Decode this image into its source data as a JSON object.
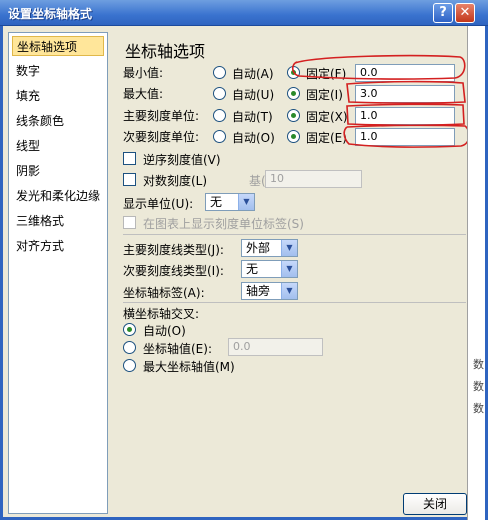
{
  "window": {
    "title": "设置坐标轴格式",
    "help_label": "?",
    "close_glyph": "✕"
  },
  "sidebar": {
    "items": [
      {
        "label": "坐标轴选项",
        "active": true
      },
      {
        "label": "数字"
      },
      {
        "label": "填充"
      },
      {
        "label": "线条颜色"
      },
      {
        "label": "线型"
      },
      {
        "label": "阴影"
      },
      {
        "label": "发光和柔化边缘"
      },
      {
        "label": "三维格式"
      },
      {
        "label": "对齐方式"
      }
    ]
  },
  "main": {
    "section_title": "坐标轴选项",
    "rows": [
      {
        "label": "最小值:",
        "auto_label": "自动(A)",
        "fixed_label": "固定(F)",
        "value": "0.0"
      },
      {
        "label": "最大值:",
        "auto_label": "自动(U)",
        "fixed_label": "固定(I)",
        "value": "3.0"
      },
      {
        "label": "主要刻度单位:",
        "auto_label": "自动(T)",
        "fixed_label": "固定(X)",
        "value": "1.0"
      },
      {
        "label": "次要刻度单位:",
        "auto_label": "自动(O)",
        "fixed_label": "固定(E)",
        "value": "1.0"
      }
    ],
    "reverse_label": "逆序刻度值(V)",
    "log_label": "对数刻度(L)",
    "base_label": "基(B):",
    "base_value": "10",
    "display_unit_label": "显示单位(U):",
    "display_unit_value": "无",
    "show_unit_label": "在图表上显示刻度单位标签(S)",
    "major_tick_label": "主要刻度线类型(J):",
    "major_tick_value": "外部",
    "minor_tick_label": "次要刻度线类型(I):",
    "minor_tick_value": "无",
    "axis_labels_label": "坐标轴标签(A):",
    "axis_labels_value": "轴旁",
    "crosses_title": "横坐标轴交叉:",
    "cross_auto": "自动(O)",
    "cross_value_label": "坐标轴值(E):",
    "cross_value": "0.0",
    "cross_max": "最大坐标轴值(M)",
    "close_label": "关闭"
  },
  "edge": {
    "glyph": "数"
  },
  "colors": {
    "annotation": "#d42020",
    "title_bar": "#3a73cf"
  }
}
